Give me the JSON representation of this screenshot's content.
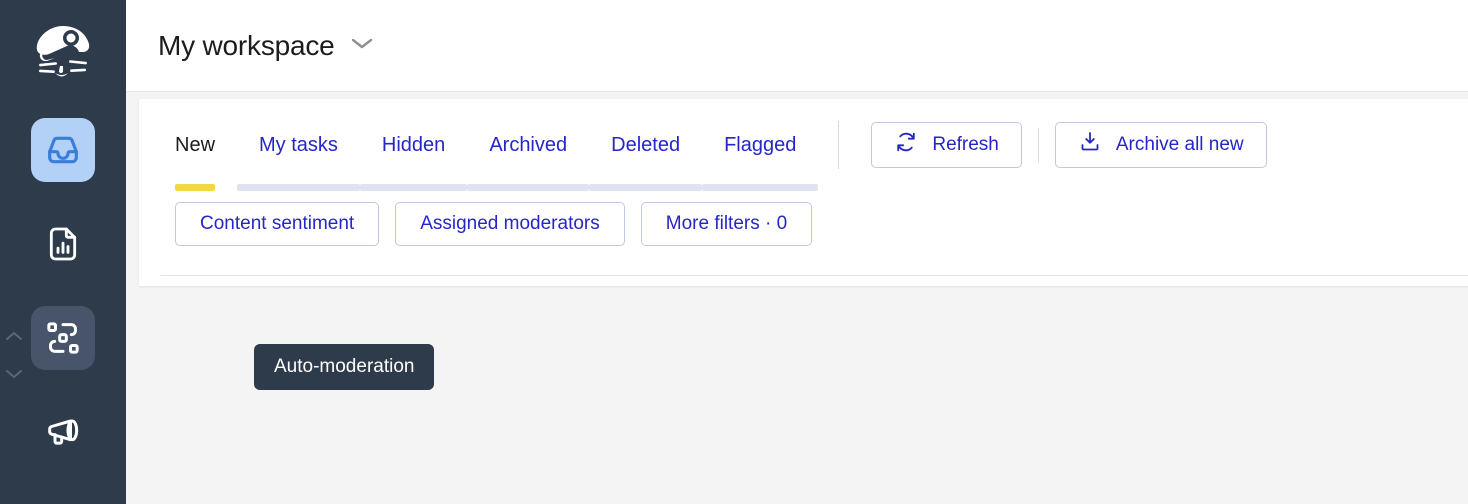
{
  "sidebar": {
    "logo": {
      "name": "app-logo",
      "alt": "mole-logo"
    },
    "items": [
      {
        "icon": "inbox-icon",
        "state": "active",
        "name": "sidebar-item-inbox"
      },
      {
        "icon": "report-document-icon",
        "state": "default",
        "name": "sidebar-item-reports"
      },
      {
        "icon": "automation-nodes-icon",
        "state": "hovered",
        "name": "sidebar-item-automation"
      },
      {
        "icon": "megaphone-icon",
        "state": "default",
        "name": "sidebar-item-announcements"
      }
    ],
    "scroll_up_icon": "chevron-up-icon",
    "scroll_down_icon": "chevron-down-icon"
  },
  "header": {
    "workspace_title": "My workspace",
    "dropdown_icon": "chevron-down-icon"
  },
  "tabs": [
    {
      "label": "New",
      "active": true
    },
    {
      "label": "My tasks",
      "active": false
    },
    {
      "label": "Hidden",
      "active": false
    },
    {
      "label": "Archived",
      "active": false
    },
    {
      "label": "Deleted",
      "active": false
    },
    {
      "label": "Flagged",
      "active": false
    }
  ],
  "actions": {
    "refresh": {
      "label": "Refresh",
      "icon": "refresh-icon"
    },
    "archive_all": {
      "label": "Archive all new",
      "icon": "archive-download-icon"
    }
  },
  "filters": [
    {
      "label": "Content sentiment",
      "name": "filter-content-sentiment"
    },
    {
      "label": "Assigned moderators",
      "name": "filter-assigned-moderators"
    },
    {
      "label": "More filters · 0",
      "name": "filter-more-filters"
    }
  ],
  "tooltip": {
    "text": "Auto-moderation"
  },
  "colors": {
    "sidebar_bg": "#2e3b4a",
    "page_bg": "#f4f4f5",
    "card_bg": "#ffffff",
    "link_blue": "#2626c8",
    "active_underline": "#f2d93c",
    "inactive_underline": "#dfe3f0",
    "active_nav_bg": "#b3d0f7",
    "hover_nav_bg": "#47546a",
    "icon_blue": "#3b7ddd",
    "text_dark": "#1c1c1e"
  }
}
